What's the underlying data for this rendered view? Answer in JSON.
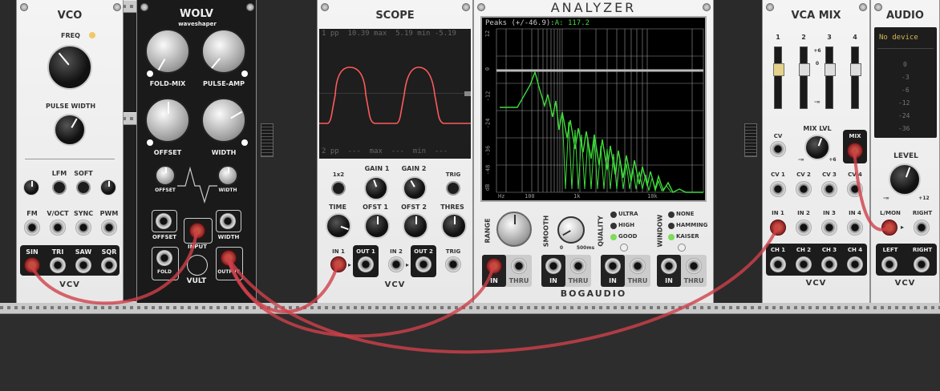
{
  "vco": {
    "title": "VCO",
    "freq": "FREQ",
    "pulse_width": "PULSE WIDTH",
    "lfm": "LFM",
    "soft": "SOFT",
    "fm": "FM",
    "voct": "V/OCT",
    "sync": "SYNC",
    "pwm": "PWM",
    "sin": "SIN",
    "tri": "TRI",
    "saw": "SAW",
    "sqr": "SQR",
    "brand": "VCV"
  },
  "wolv": {
    "title": "WOLV",
    "subtitle": "waveshaper",
    "fold_mix": "FOLD-MIX",
    "pulse_amp": "PULSE-AMP",
    "offset": "OFFSET",
    "width": "WIDTH",
    "small_offset": "OFFSET",
    "small_width": "WIDTH",
    "jack_offset": "OFFSET",
    "jack_input": "INPUT",
    "jack_width": "WIDTH",
    "fold": "FOLD",
    "output": "OUTPUT",
    "brand": "VULT"
  },
  "scope": {
    "title": "SCOPE",
    "line1": "1 pp  10.39 max  5.19 min -5.19",
    "line2": "2 pp  ---  max  ---  min  ---",
    "x12": "1x2",
    "gain1": "GAIN 1",
    "gain2": "GAIN 2",
    "trig": "TRIG",
    "time": "TIME",
    "ofst1": "OFST 1",
    "ofst2": "OFST 2",
    "thres": "THRES",
    "in1": "IN 1",
    "out1": "OUT 1",
    "in2": "IN 2",
    "out2": "OUT 2",
    "trig_jack": "TRIG",
    "brand": "VCV"
  },
  "analyzer": {
    "title": "ANALYZER",
    "peaks_label": "Peaks (+/-46.9):",
    "peaks_ch": "A:",
    "peaks_value": "117.2",
    "y_ticks": [
      "12",
      "0",
      "-12",
      "-24",
      "-36",
      "-48",
      "dB"
    ],
    "x_ticks": [
      "Hz",
      "100",
      "1k",
      "10k"
    ],
    "range": "RANGE",
    "smooth": "SMOOTH",
    "smooth_min": "0",
    "smooth_max": "500ms",
    "quality": "QUALITY",
    "quality_opts": [
      "ULTRA",
      "HIGH",
      "GOOD"
    ],
    "window": "WINDOW",
    "window_opts": [
      "NONE",
      "HAMMING",
      "KAISER"
    ],
    "in": "IN",
    "thru": "THRU",
    "brand": "BOGAUDIO"
  },
  "vcamix": {
    "title": "VCA MIX",
    "ch_nums": [
      "1",
      "2",
      "3",
      "4"
    ],
    "scale": [
      "+6",
      "0",
      "-∞"
    ],
    "mix_lvl": "MIX LVL",
    "mix_min": "-∞",
    "mix_max": "+6",
    "cv": "CV",
    "mix": "MIX",
    "cv_labels": [
      "CV 1",
      "CV 2",
      "CV 3",
      "CV 4"
    ],
    "in_labels": [
      "IN 1",
      "IN 2",
      "IN 3",
      "IN 4"
    ],
    "ch_labels": [
      "CH 1",
      "CH 2",
      "CH 3",
      "CH 4"
    ],
    "brand": "VCV"
  },
  "audio": {
    "title": "AUDIO",
    "device": "No device",
    "levels": [
      "0",
      "-3",
      "-6",
      "-12",
      "-24",
      "-36"
    ],
    "level": "LEVEL",
    "level_min": "-∞",
    "level_max": "+12",
    "lmon": "L/MON",
    "right": "RIGHT",
    "left": "LEFT",
    "right_out": "RIGHT",
    "brand": "VCV"
  },
  "colors": {
    "cable": "#d0404a",
    "spectrum": "#3ddc3a",
    "scope_trace": "#ff5a5a"
  }
}
